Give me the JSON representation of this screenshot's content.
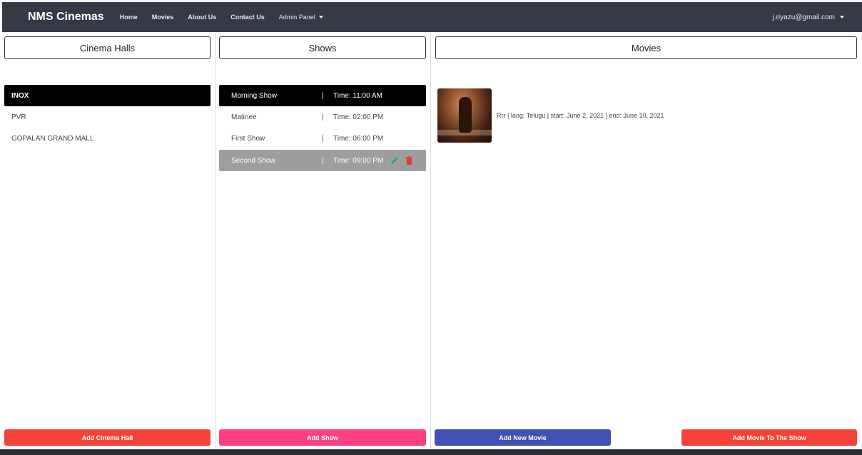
{
  "navbar": {
    "brand": "NMS Cinemas",
    "links": [
      "Home",
      "Movies",
      "About Us",
      "Contact Us"
    ],
    "admin_label": "Admin Panel",
    "user_email": "j.riyazu@gmail.com"
  },
  "halls": {
    "title": "Cinema Halls",
    "items": [
      {
        "label": "INOX",
        "active": true
      },
      {
        "label": "PVR",
        "active": false
      },
      {
        "label": "GOPALAN GRAND MALL",
        "active": false
      }
    ],
    "add_label": "Add Cinema Hall"
  },
  "shows": {
    "title": "Shows",
    "separator": "|",
    "items": [
      {
        "name": "Morning Show",
        "time": "Time: 11:00 AM",
        "state": "active"
      },
      {
        "name": "Matinee",
        "time": "Time: 02:00 PM",
        "state": "normal"
      },
      {
        "name": "First Show",
        "time": "Time: 06:00 PM",
        "state": "normal"
      },
      {
        "name": "Second Show",
        "time": "Time: 09:00 PM",
        "state": "hover"
      }
    ],
    "add_label": "Add Show"
  },
  "movies": {
    "title": "Movies",
    "items": [
      {
        "text": "Rrr | lang: Telugu | start: June 2, 2021 | end: June 10, 2021"
      }
    ],
    "add_new_label": "Add New Movie",
    "add_to_show_label": "Add Movie To The Show"
  },
  "colors": {
    "navbar_bg": "#353a47",
    "add_hall": "#f44336",
    "add_show": "#ff4081",
    "add_movie": "#3f51b5",
    "add_movie_to_show": "#f44336",
    "edit_icon": "#26a69a",
    "delete_icon": "#e53935"
  }
}
